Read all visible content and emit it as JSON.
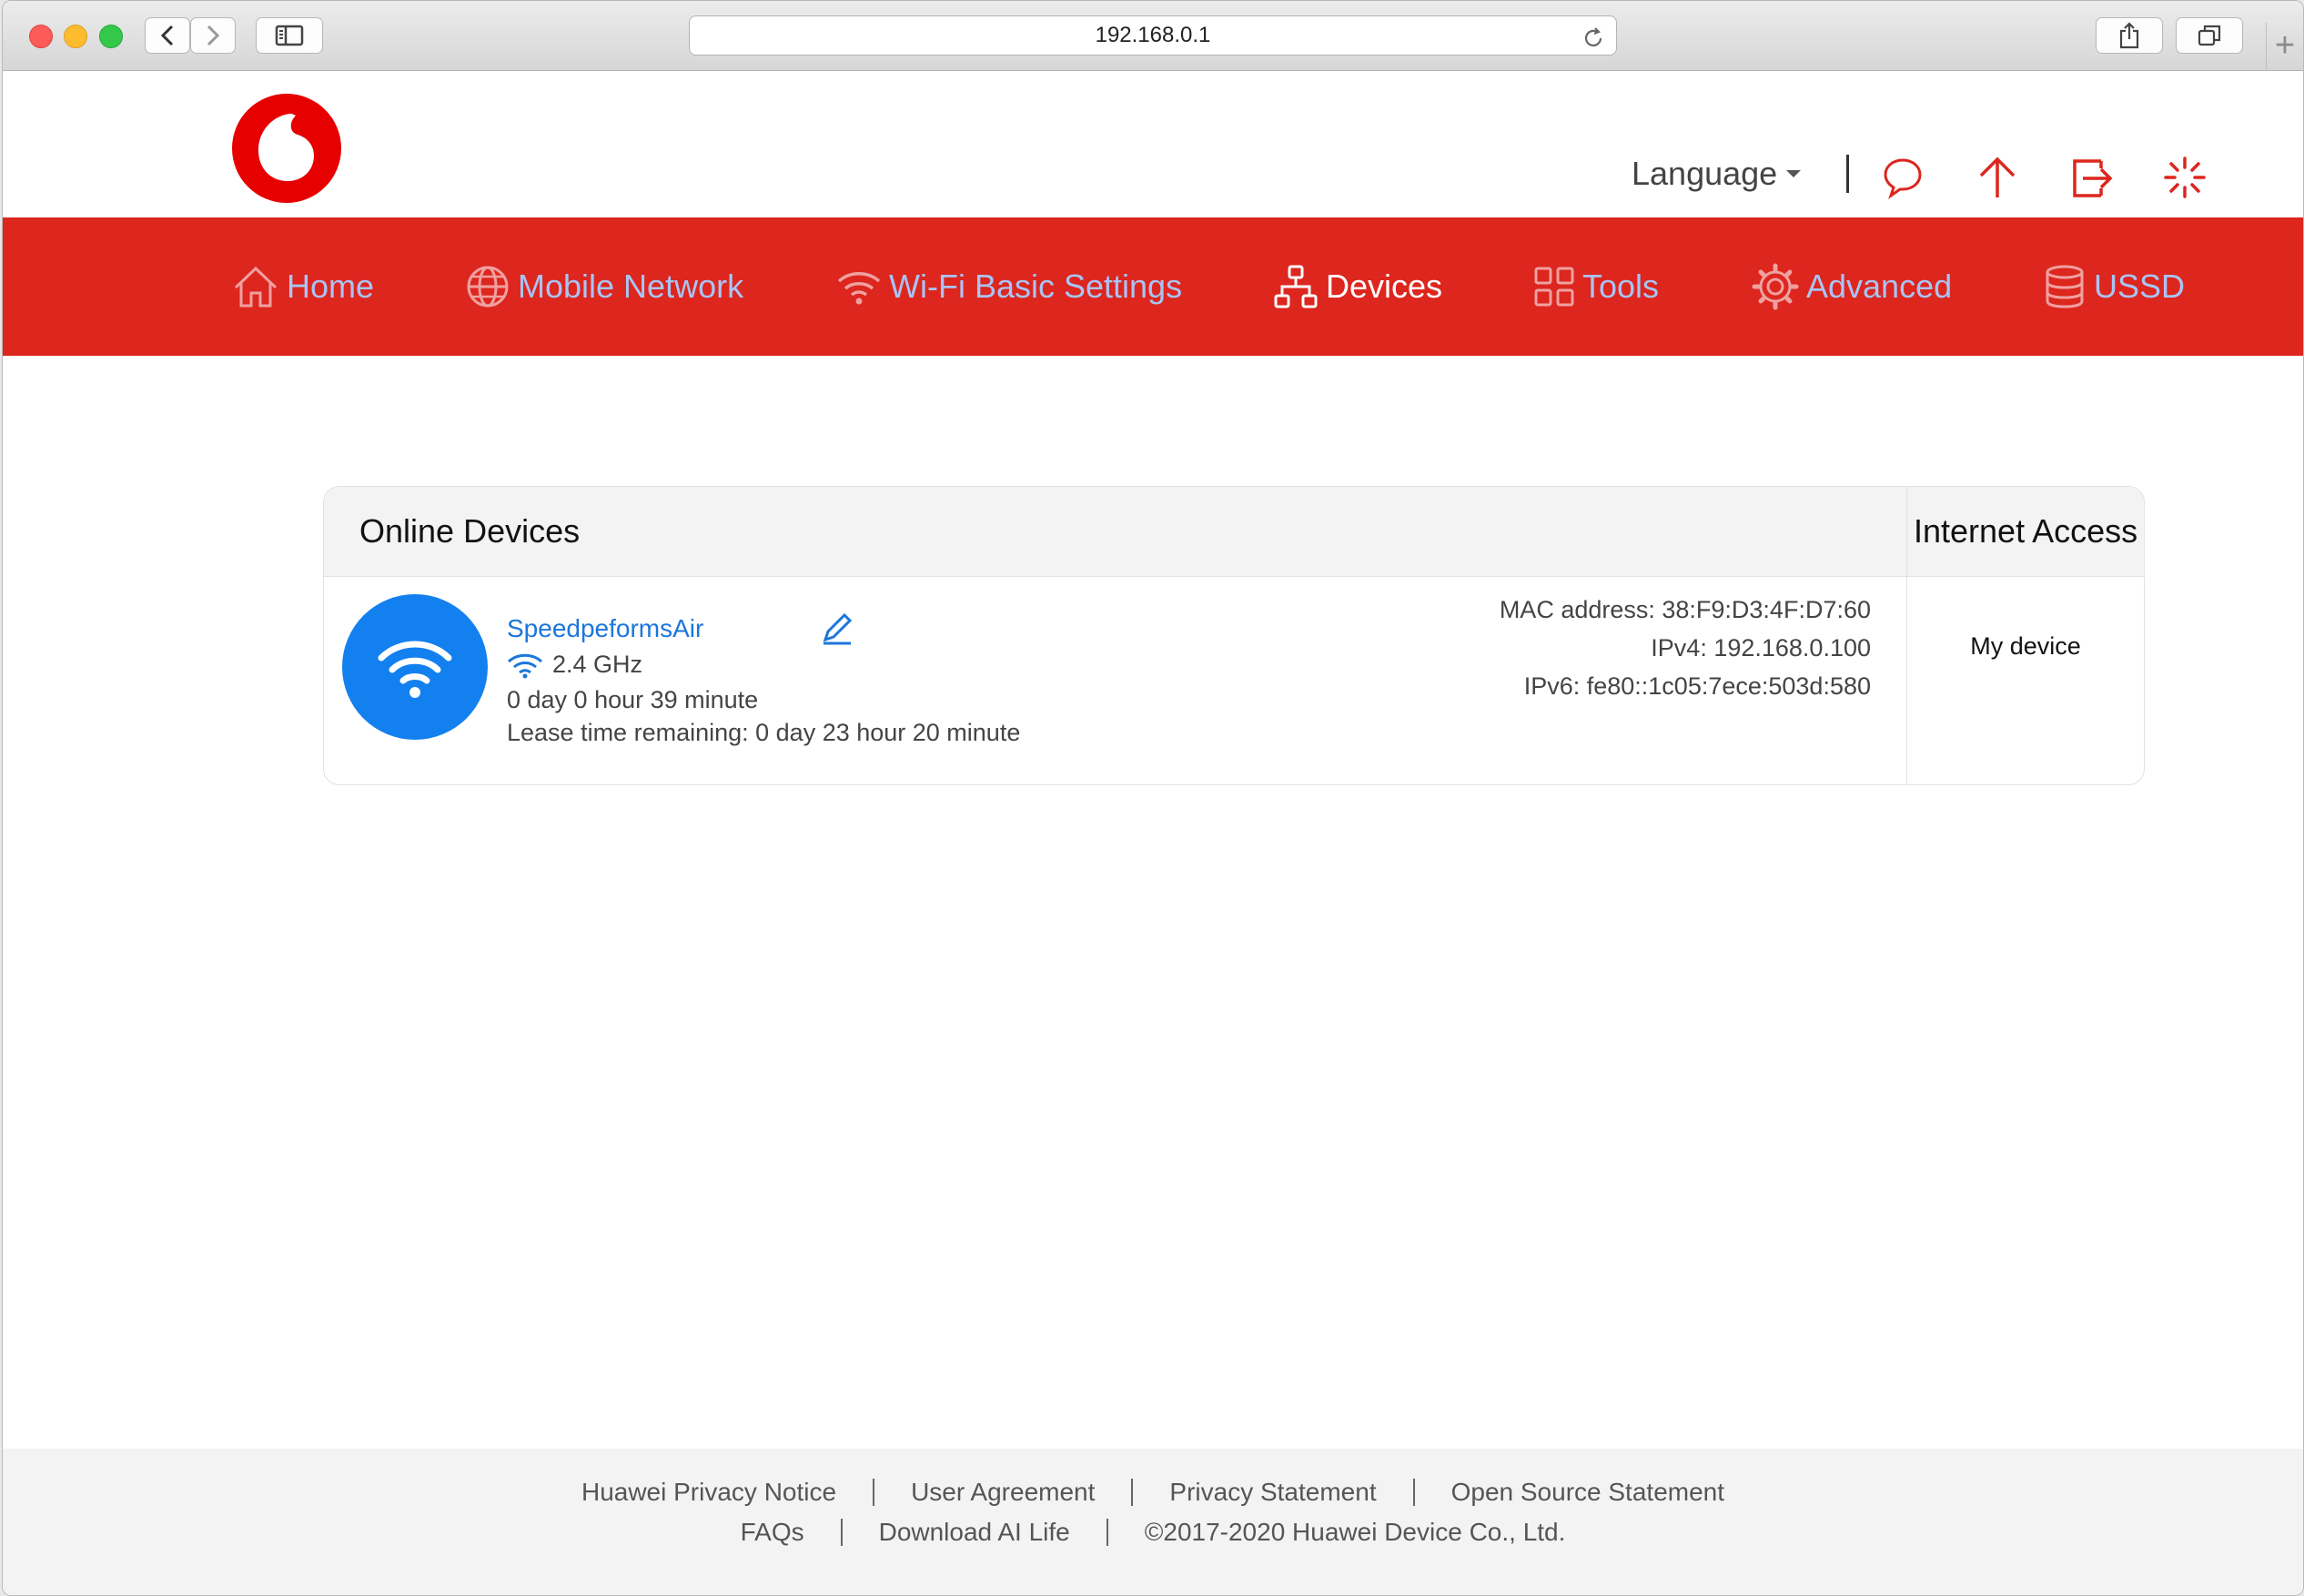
{
  "browser": {
    "url": "192.168.0.1",
    "new_tab": "+"
  },
  "header": {
    "language_label": "Language"
  },
  "nav": {
    "items": [
      {
        "label": "Home",
        "icon": "home-icon"
      },
      {
        "label": "Mobile Network",
        "icon": "globe-icon"
      },
      {
        "label": "Wi-Fi Basic Settings",
        "icon": "wifi-icon"
      },
      {
        "label": "Devices",
        "icon": "network-devices-icon"
      },
      {
        "label": "Tools",
        "icon": "grid-tools-icon"
      },
      {
        "label": "Advanced",
        "icon": "gear-icon"
      },
      {
        "label": "USSD",
        "icon": "database-icon"
      }
    ],
    "active": "Devices"
  },
  "devices": {
    "online_title": "Online Devices",
    "access_title": "Internet Access",
    "list": [
      {
        "name": "SpeedpeformsAir",
        "band": "2.4 GHz",
        "uptime": "0 day 0 hour 39 minute",
        "lease": "Lease time remaining: 0 day 23 hour 20 minute",
        "mac": "MAC address: 38:F9:D3:4F:D7:60",
        "ipv4": "IPv4: 192.168.0.100",
        "ipv6": "IPv6: fe80::1c05:7ece:503d:580",
        "access": "My device"
      }
    ]
  },
  "footer": {
    "row1": [
      "Huawei Privacy Notice",
      "User Agreement",
      "Privacy Statement",
      "Open Source Statement"
    ],
    "row2": [
      "FAQs",
      "Download AI Life",
      "©2017-2020 Huawei Device Co., Ltd."
    ]
  },
  "colors": {
    "brand_red": "#dc261e",
    "nav_link": "#a9c4f4",
    "link_blue": "#1c76db",
    "avatar_blue": "#1380f0"
  }
}
